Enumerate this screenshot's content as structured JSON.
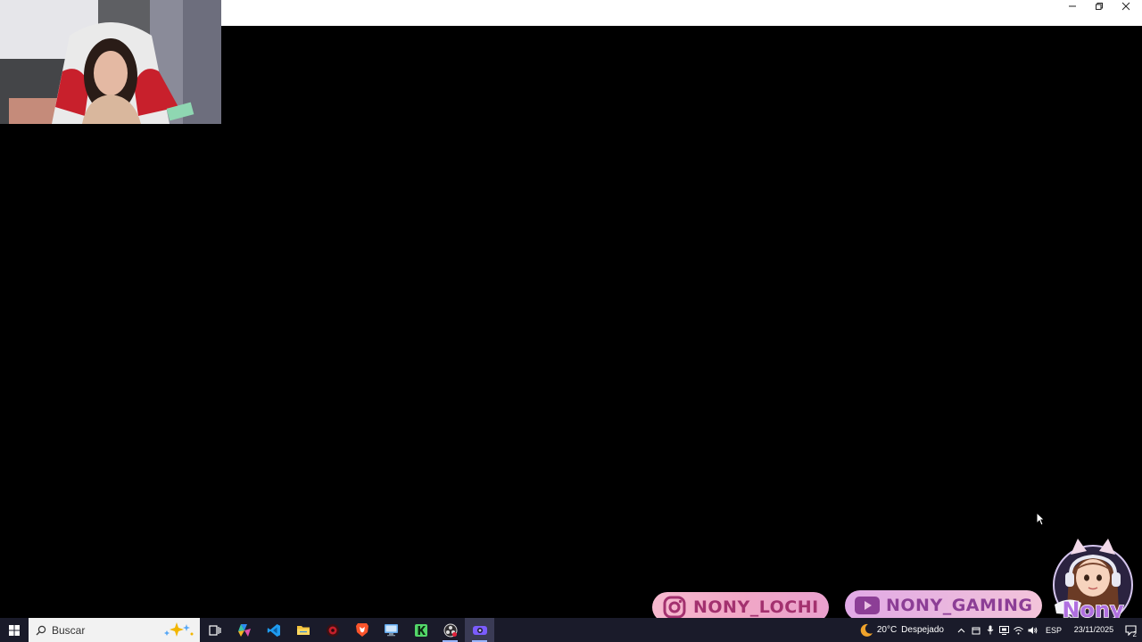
{
  "window": {
    "controls": [
      "minimize-icon",
      "restore-icon",
      "close-icon"
    ]
  },
  "overlay": {
    "instagram_handle": "NONY_LOCHI",
    "youtube_handle": "NONY_GAMING",
    "avatar_text": "Nony",
    "colors": {
      "instagram_text": "#a3316f",
      "youtube_text": "#8c3e96",
      "avatar_text": "#b070e0"
    }
  },
  "taskbar": {
    "search_placeholder": "Buscar",
    "apps": [
      {
        "icon": "task-view-icon"
      },
      {
        "icon": "copilot-icon"
      },
      {
        "icon": "vscode-icon"
      },
      {
        "icon": "file-explorer-icon"
      },
      {
        "icon": "game-launcher-icon"
      },
      {
        "icon": "brave-browser-icon"
      },
      {
        "icon": "remote-desktop-icon"
      },
      {
        "icon": "app-k-icon"
      },
      {
        "icon": "obs-studio-icon"
      },
      {
        "icon": "streaming-app-icon"
      }
    ],
    "tray": {
      "temperature": "20°C",
      "weather": "Despejado",
      "language": "ESP",
      "date": "23/11/2025",
      "notification_count": "2"
    },
    "colors": {
      "background": "#1a1b2a",
      "search_background": "#f2f2f2"
    }
  }
}
